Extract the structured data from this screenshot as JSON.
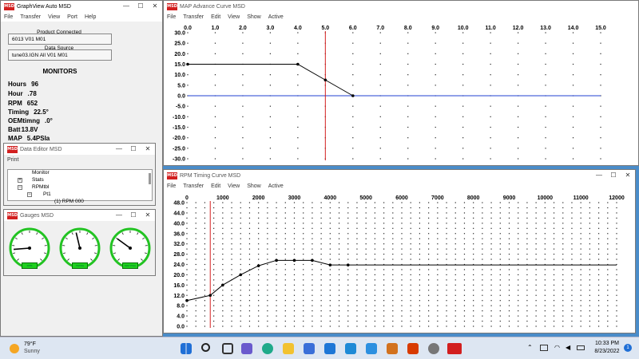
{
  "main_window": {
    "title": "GraphView Auto MSD",
    "logo": "MSD",
    "menu": [
      "File",
      "Transfer",
      "View",
      "Port",
      "Help"
    ],
    "product_label": "Product Connected",
    "product_value": "6013 V01 M01",
    "source_label": "Data Source",
    "source_value": "tune03.IGN All V01 M01",
    "monitors_title": "MONITORS",
    "monitors": [
      {
        "label": "Hours",
        "value": "96"
      },
      {
        "label": "Hour",
        "value": ".78"
      },
      {
        "label": "RPM",
        "value": "652"
      },
      {
        "label": "Timing",
        "value": "22.5°"
      },
      {
        "label": "OEMtimng",
        "value": ".0°"
      },
      {
        "label": "Batt",
        "value": "13.8V"
      },
      {
        "label": "MAP",
        "value": "5.4PSIa"
      }
    ]
  },
  "data_editor": {
    "title": "Data Editor  MSD",
    "menu": [
      "Print"
    ],
    "tree": [
      {
        "label": "Monitor",
        "expander": ""
      },
      {
        "label": "Stats",
        "expander": "+"
      },
      {
        "label": "RPMtbl",
        "expander": "−"
      },
      {
        "label": "Pt1",
        "expander": "−"
      },
      {
        "label": "(1) RPM   000",
        "expander": ""
      }
    ]
  },
  "gauges_window": {
    "title": "Gauges  MSD",
    "gauges": [
      {
        "label": "RPM",
        "value_fraction": 0.15
      },
      {
        "label": "TIMING",
        "value_fraction": 0.45
      },
      {
        "label": "MAP PSIA",
        "value_fraction": 0.3
      }
    ]
  },
  "map_window": {
    "title": "MAP Advance Curve  MSD",
    "menu": [
      "File",
      "Transfer",
      "Edit",
      "View",
      "Show",
      "Active"
    ]
  },
  "rpm_window": {
    "title": "RPM Timing Curve  MSD",
    "menu": [
      "File",
      "Transfer",
      "Edit",
      "View",
      "Show",
      "Active"
    ]
  },
  "chart_data": [
    {
      "type": "line",
      "x_ticks": [
        "0.0",
        "1.0",
        "2.0",
        "3.0",
        "4.0",
        "5.0",
        "6.0",
        "7.0",
        "8.0",
        "9.0",
        "10.0",
        "11.0",
        "12.0",
        "13.0",
        "14.0",
        "15.0"
      ],
      "y_ticks": [
        "30.0",
        "25.0",
        "20.0",
        "15.0",
        "10.0",
        "5.0",
        "0.0",
        "-5.0",
        "-10.0",
        "-15.0",
        "-20.0",
        "-25.0",
        "-30.0"
      ],
      "xlim": [
        0,
        15
      ],
      "ylim": [
        -30,
        30
      ],
      "points": [
        [
          0,
          15
        ],
        [
          4,
          15
        ],
        [
          5,
          7.5
        ],
        [
          6,
          0
        ]
      ],
      "cursor_x": 5,
      "baseline_y": 0,
      "line_color": "#000000",
      "cursor_color": "#d42020",
      "baseline_color": "#2040d0"
    },
    {
      "type": "line",
      "x_ticks": [
        "0",
        "1000",
        "2000",
        "3000",
        "4000",
        "5000",
        "6000",
        "7000",
        "8000",
        "9000",
        "10000",
        "11000",
        "12000"
      ],
      "y_ticks": [
        "48.0",
        "44.0",
        "40.0",
        "36.0",
        "32.0",
        "28.0",
        "24.0",
        "20.0",
        "16.0",
        "12.0",
        "8.0",
        "4.0",
        "0.0"
      ],
      "xlim": [
        0,
        12000
      ],
      "ylim": [
        0,
        48
      ],
      "points": [
        [
          0,
          10
        ],
        [
          652,
          12
        ],
        [
          1000,
          16
        ],
        [
          1500,
          20
        ],
        [
          2000,
          23.5
        ],
        [
          2500,
          25.6
        ],
        [
          3000,
          25.6
        ],
        [
          3500,
          25.6
        ],
        [
          4000,
          23.8
        ],
        [
          4500,
          23.8
        ],
        [
          5000,
          23.8
        ],
        [
          12000,
          23.8
        ]
      ],
      "markers_until_x": 4500,
      "cursor_x": 652,
      "line_color": "#000000",
      "cursor_color": "#d42020"
    }
  ],
  "taskbar": {
    "weather_temp": "79°F",
    "weather_desc": "Sunny",
    "time": "10:33 PM",
    "date": "8/23/2022",
    "notification_count": "1"
  }
}
